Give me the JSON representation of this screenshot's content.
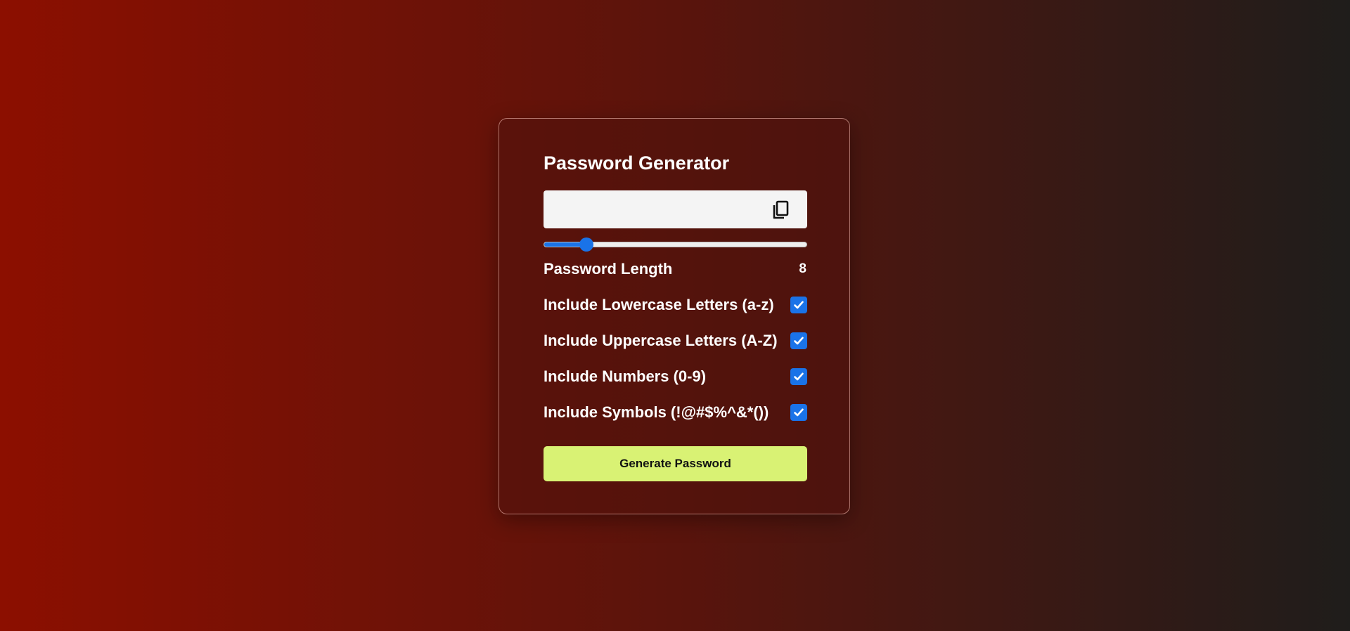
{
  "app": {
    "title": "Password Generator"
  },
  "output": {
    "value": "",
    "copy_icon": "copy-icon"
  },
  "length": {
    "label": "Password Length",
    "value": 8,
    "min": 4,
    "max": 32
  },
  "options": [
    {
      "label": "Include Lowercase Letters (a-z)",
      "checked": true
    },
    {
      "label": "Include Uppercase Letters (A-Z)",
      "checked": true
    },
    {
      "label": "Include Numbers (0-9)",
      "checked": true
    },
    {
      "label": "Include Symbols (!@#$%^&*())",
      "checked": true
    }
  ],
  "generate": {
    "label": "Generate Password"
  },
  "colors": {
    "accent": "#1a73e8",
    "button": "#d9f274",
    "background_start": "#8c0f00",
    "background_end": "#1f1d1b"
  }
}
